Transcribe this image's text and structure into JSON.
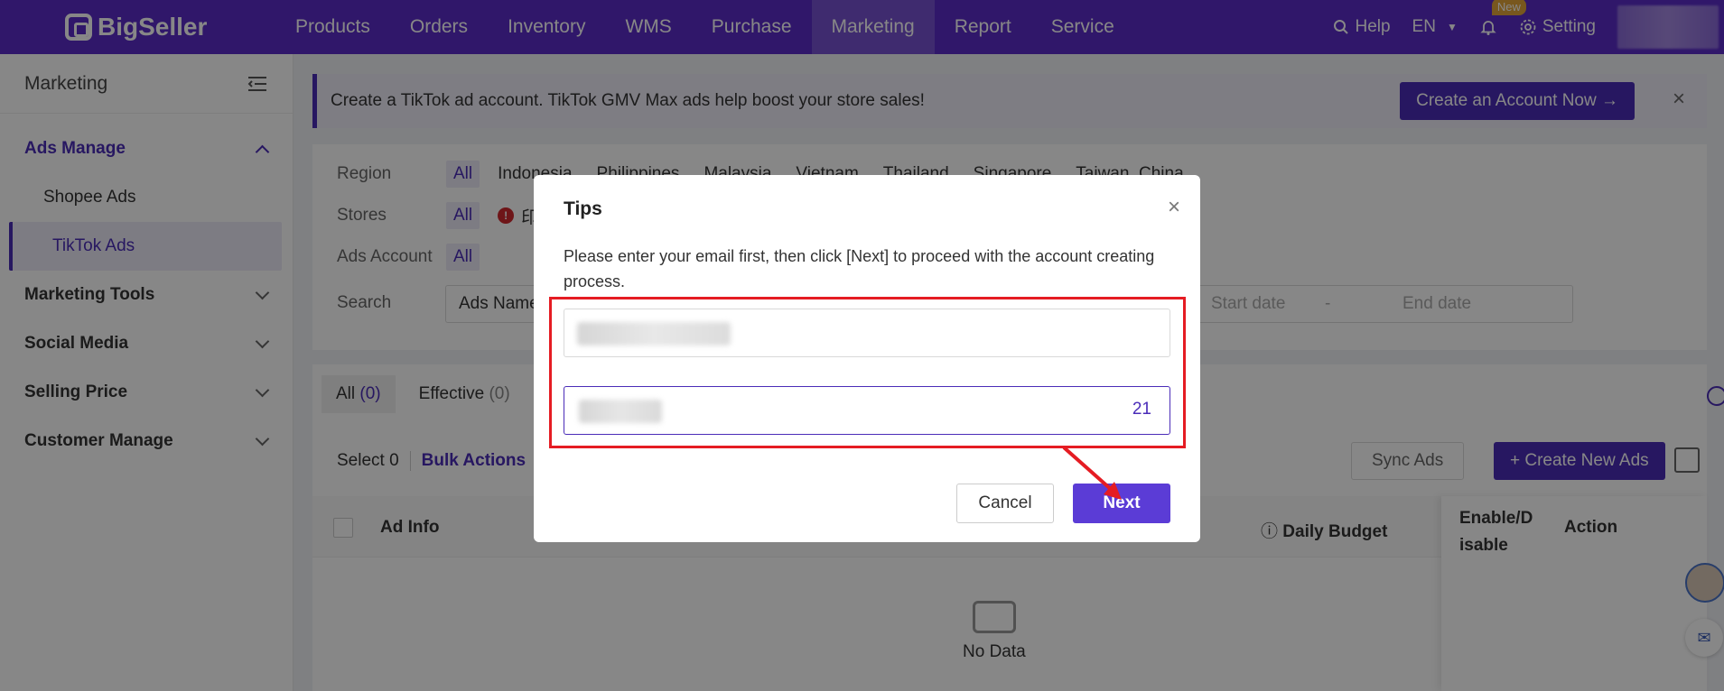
{
  "topnav": {
    "brand": "BigSeller",
    "items": [
      "Products",
      "Orders",
      "Inventory",
      "WMS",
      "Purchase",
      "Marketing",
      "Report",
      "Service"
    ],
    "active": "Marketing",
    "help": "Help",
    "lang": "EN",
    "new_badge": "New",
    "setting": "Setting"
  },
  "sidebar": {
    "title": "Marketing",
    "groups": [
      {
        "label": "Ads Manage",
        "open": true,
        "subs": [
          "Shopee Ads",
          "TikTok Ads"
        ],
        "active_sub": "TikTok Ads"
      },
      {
        "label": "Marketing Tools"
      },
      {
        "label": "Social Media"
      },
      {
        "label": "Selling Price"
      },
      {
        "label": "Customer Manage"
      }
    ]
  },
  "banner": {
    "text": "Create a TikTok ad account. TikTok GMV Max ads help boost your store sales!",
    "button": "Create an Account Now →",
    "close": "×"
  },
  "filters": {
    "region_label": "Region",
    "region_all": "All",
    "regions": [
      "Indonesia",
      "Philippines",
      "Malaysia",
      "Vietnam",
      "Thailand",
      "Singapore",
      "Taiwan, China"
    ],
    "stores_label": "Stores",
    "stores_all": "All",
    "store_warn": "!",
    "store_first": "印",
    "ads_account_label": "Ads Account",
    "ads_account_all": "All",
    "search_label": "Search",
    "search_field": "Ads Name",
    "start_date": "Start date",
    "date_sep": "-",
    "end_date": "End date"
  },
  "list": {
    "tabs": [
      {
        "label": "All",
        "count": "(0)",
        "active": true
      },
      {
        "label": "Effective",
        "count": "(0)",
        "active": false
      }
    ],
    "select_label": "Select 0",
    "bulk_actions": "Bulk Actions",
    "sync_ads": "Sync Ads",
    "create_new": "+ Create New Ads",
    "columns": {
      "ad_info": "Ad Info",
      "daily_budget": "Daily Budget",
      "enable_disable": "Enable/D isable",
      "action": "Action"
    },
    "no_data": "No Data"
  },
  "modal": {
    "title": "Tips",
    "close": "×",
    "description": "Please enter your email first, then click [Next] to proceed with the account creating process.",
    "code_counter": "21",
    "cancel": "Cancel",
    "next": "Next"
  },
  "colors": {
    "brand": "#5b2cc9",
    "accent": "#4a2cb8",
    "highlight": "#e51c23"
  }
}
